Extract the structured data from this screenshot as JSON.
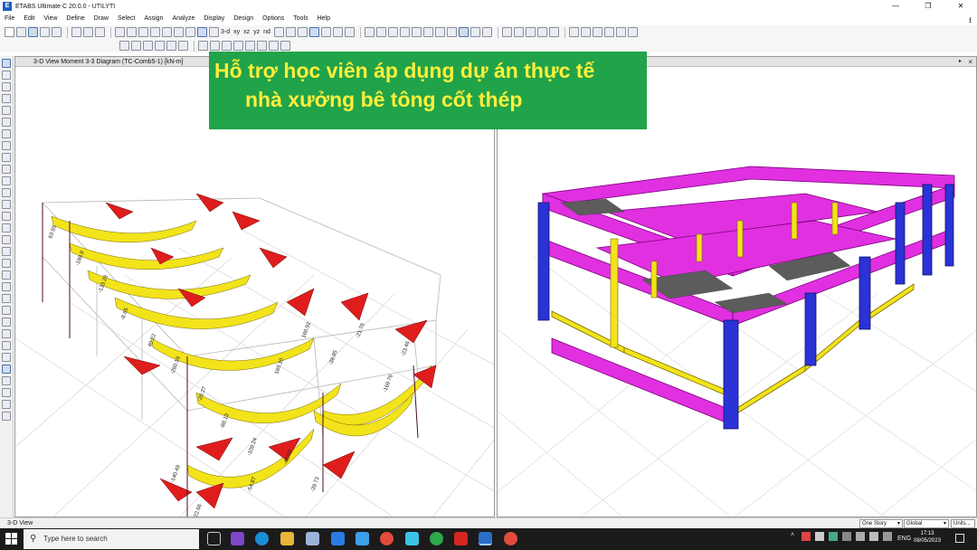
{
  "window": {
    "title": "ETABS Ultimate C 20.0.0 - UTILYTI",
    "app_icon": "E",
    "controls": [
      "—",
      "❐",
      "✕"
    ]
  },
  "menu": [
    "File",
    "Edit",
    "View",
    "Define",
    "Draw",
    "Select",
    "Assign",
    "Analyze",
    "Display",
    "Design",
    "Options",
    "Tools",
    "Help"
  ],
  "toolbar": {
    "label_3d": "3-d",
    "label_xy": "xy",
    "label_xz": "xz",
    "label_yz": "yz",
    "label_nd": "nd"
  },
  "viewport_left": {
    "title": "3-D View    Moment 3-3 Diagram   (TC-Comb5-1)  [kN-m]",
    "close": "×",
    "chart_labels": [
      "63.55",
      "-188.8",
      "-133.28",
      "-8.65",
      "40.22",
      "-260.19",
      "-20.27",
      "-88.13",
      "-109.24",
      "165.10",
      "160.92",
      "-39.85",
      "-21.76",
      "-169.76",
      "-23.46",
      "-140.49",
      "-22.66",
      "-54.87",
      "-40.63",
      "-39.73"
    ]
  },
  "viewport_right": {
    "title": "",
    "close": "×"
  },
  "banner": {
    "line1": "Hỗ trợ học viên áp dụng dự án thực tế",
    "line2": "nhà xưởng bê tông cốt thép"
  },
  "statusbar": {
    "text": "3-D View",
    "story": "One Story",
    "coord": "Global",
    "units": "Units..."
  },
  "taskbar": {
    "search_placeholder": "Type here to search",
    "lang": "ENG",
    "time": "17:13",
    "date": "08/05/2023"
  },
  "colors": {
    "banner_bg": "#21a34a",
    "banner_text": "#ffef3b",
    "beam": "#e030e0",
    "column": "#2b32d6",
    "yellow": "#f2e31a",
    "red": "#e01d1d"
  }
}
